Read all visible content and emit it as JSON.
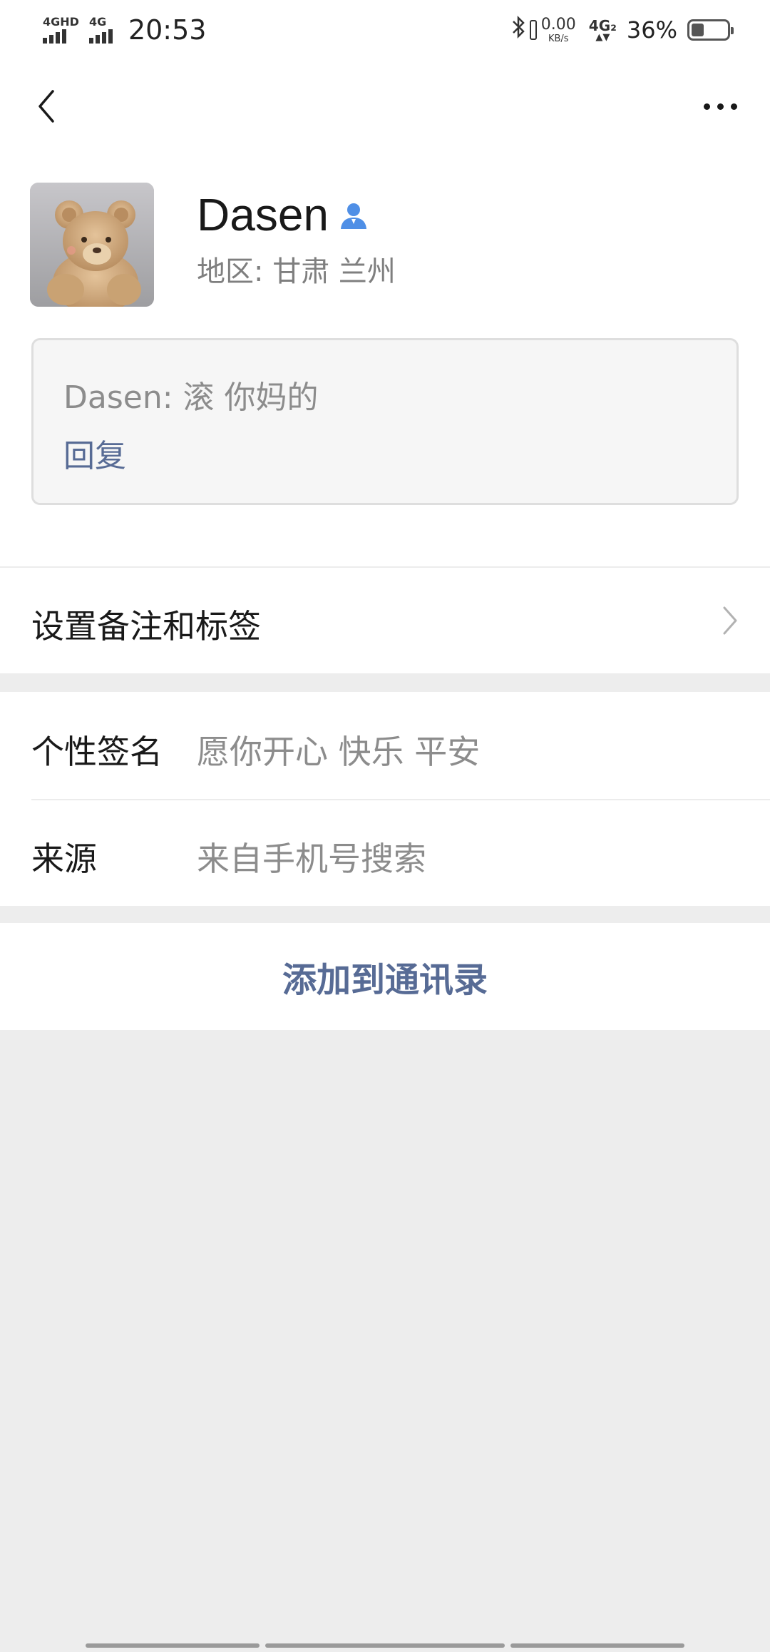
{
  "status_bar": {
    "signal1_label": "4GHD",
    "signal2_label": "4G",
    "time": "20:53",
    "bluetooth_icon": "bluetooth-icon",
    "speed_value": "0.00",
    "speed_unit": "KB/s",
    "network_label": "4G₂",
    "battery_percent": "36%",
    "battery_level": 0.36
  },
  "nav": {
    "back_icon": "chevron-left-icon",
    "more_icon": "more-horizontal-icon"
  },
  "profile": {
    "name": "Dasen",
    "contact_icon": "person-icon",
    "contact_icon_color": "#4f8fe6",
    "region": "地区:  甘肃  兰州",
    "message": "Dasen: 滚  你妈的",
    "reply_label": "回复"
  },
  "remark": {
    "label": "设置备注和标签",
    "chevron_icon": "chevron-right-icon"
  },
  "info": {
    "signature_label": "个性签名",
    "signature_value": "愿你开心  快乐  平安",
    "source_label": "来源",
    "source_value": "来自手机号搜索"
  },
  "actions": {
    "add_to_contacts": "添加到通讯录",
    "link_color": "#576b95"
  }
}
